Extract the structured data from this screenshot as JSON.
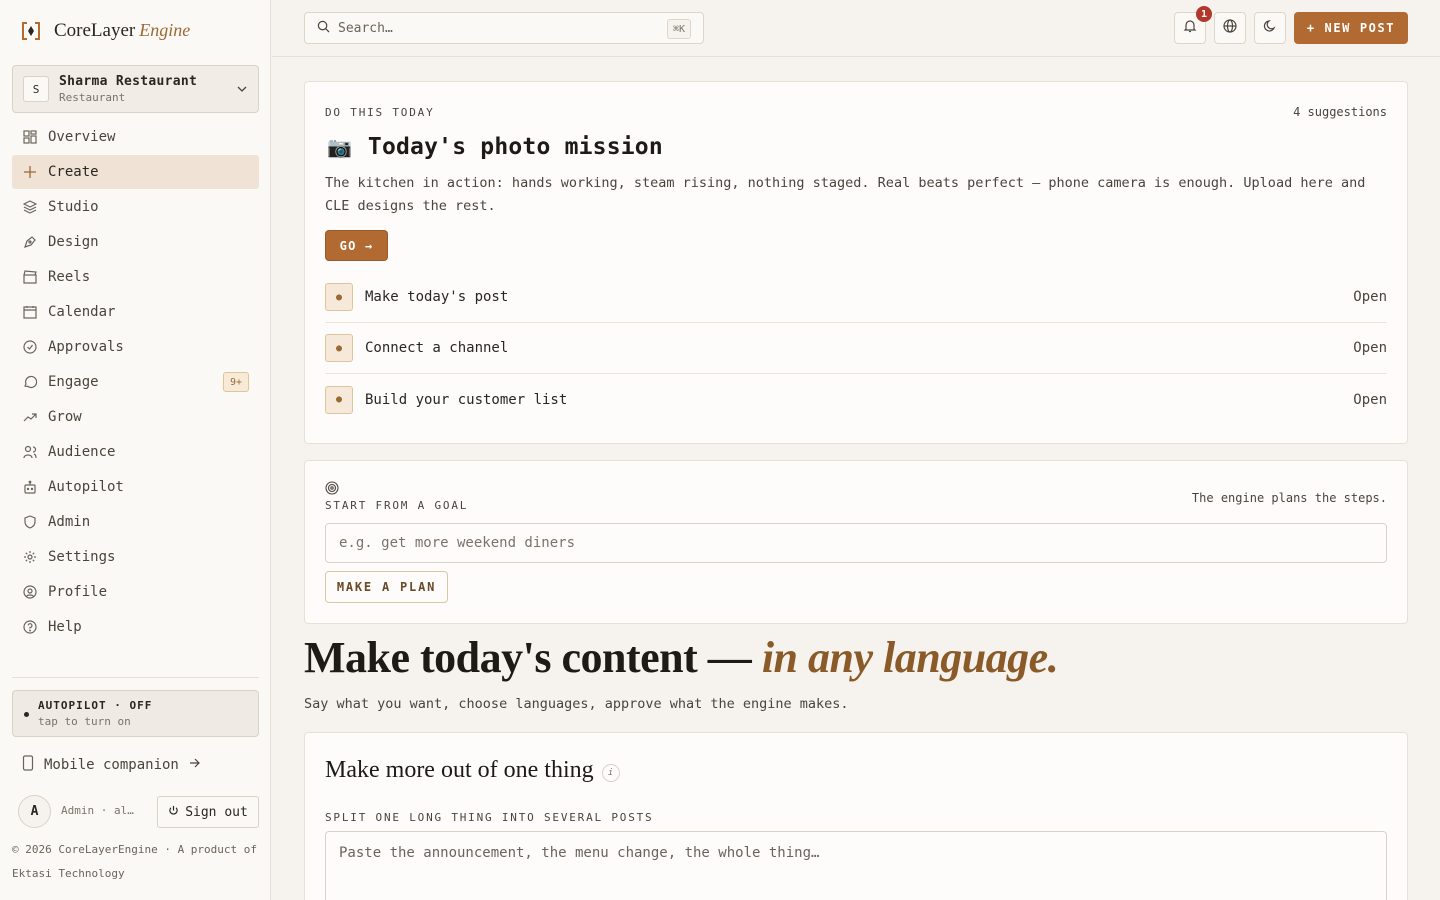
{
  "brand": {
    "name": "CoreLayer",
    "sub": "Engine"
  },
  "business": {
    "initial": "S",
    "name": "Sharma Restaurant",
    "type": "Restaurant"
  },
  "nav": [
    {
      "label": "Overview",
      "icon": "grid-icon"
    },
    {
      "label": "Create",
      "icon": "plus-icon",
      "active": true
    },
    {
      "label": "Studio",
      "icon": "layers-icon"
    },
    {
      "label": "Design",
      "icon": "pen-tool-icon"
    },
    {
      "label": "Reels",
      "icon": "clapperboard-icon"
    },
    {
      "label": "Calendar",
      "icon": "calendar-icon"
    },
    {
      "label": "Approvals",
      "icon": "check-circle-icon"
    },
    {
      "label": "Engage",
      "icon": "chat-bubble-icon",
      "badge": "9+"
    },
    {
      "label": "Grow",
      "icon": "trending-up-icon"
    },
    {
      "label": "Audience",
      "icon": "users-icon"
    },
    {
      "label": "Autopilot",
      "icon": "bot-icon"
    },
    {
      "label": "Admin",
      "icon": "shield-icon"
    },
    {
      "label": "Settings",
      "icon": "gear-icon"
    },
    {
      "label": "Profile",
      "icon": "user-circle-icon"
    },
    {
      "label": "Help",
      "icon": "help-circle-icon"
    }
  ],
  "autopilot": {
    "title": "AUTOPILOT · OFF",
    "sub": "tap to turn on"
  },
  "mobile": {
    "label": "Mobile companion"
  },
  "user": {
    "initial": "A",
    "name": "Admin · al…",
    "signout": "Sign out"
  },
  "copyright": "© 2026 CoreLayerEngine · A product of Ektasi Technology",
  "topbar": {
    "search_placeholder": "Search…",
    "search_shortcut": "⌘K",
    "notifications_count": "1",
    "new_post": "+ NEW POST"
  },
  "mission": {
    "eyebrow": "DO THIS TODAY",
    "count": "4 suggestions",
    "emoji": "📷",
    "title": "Today's photo mission",
    "description": "The kitchen in action: hands working, steam rising, nothing staged. Real beats perfect — phone camera is enough. Upload here and CLE designs the rest.",
    "go": "GO →",
    "tasks": [
      {
        "label": "Make today's post",
        "action": "Open"
      },
      {
        "label": "Connect a channel",
        "action": "Open"
      },
      {
        "label": "Build your customer list",
        "action": "Open"
      }
    ]
  },
  "goal": {
    "eyebrow": "START FROM A GOAL",
    "note": "The engine plans the steps.",
    "placeholder": "e.g. get more weekend diners",
    "button": "MAKE A PLAN"
  },
  "hero": {
    "main": "Make today's content — ",
    "accent": "in any language.",
    "sub": "Say what you want, choose languages, approve what the engine makes."
  },
  "split": {
    "title": "Make more out of one thing",
    "info": "i",
    "eyebrow": "SPLIT ONE LONG THING INTO SEVERAL POSTS",
    "placeholder": "Paste the announcement, the menu change, the whole thing…"
  },
  "colors": {
    "accent": "#b06a32",
    "accent_text": "#8a5a28",
    "badge_red": "#b2382b",
    "active_bg": "#f0e2d4"
  }
}
